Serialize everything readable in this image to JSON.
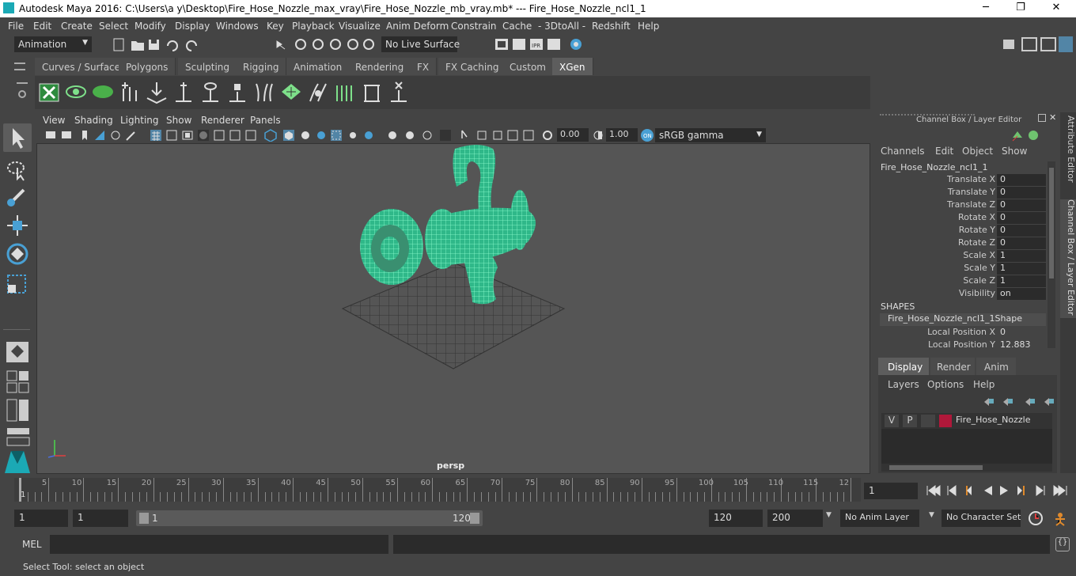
{
  "window": {
    "title": "Autodesk Maya 2016: C:\\Users\\a y\\Desktop\\Fire_Hose_Nozzle_max_vray\\Fire_Hose_Nozzle_mb_vray.mb*   ---   Fire_Hose_Nozzle_ncl1_1",
    "minimize": "─",
    "maximize": "❐",
    "close": "✕"
  },
  "menubar": [
    "File",
    "Edit",
    "Create",
    "Select",
    "Modify",
    "Display",
    "Windows",
    "Key",
    "Playback",
    "Visualize",
    "Anim Deform",
    "Constrain",
    "Cache",
    "- 3DtoAll -",
    "Redshift",
    "Help"
  ],
  "toolbar": {
    "menuset": "Animation",
    "live_surface": "No Live Surface"
  },
  "shelf_tabs": [
    "Curves / Surfaces",
    "Polygons",
    "Sculpting",
    "Rigging",
    "Animation",
    "Rendering",
    "FX",
    "FX Caching",
    "Custom",
    "XGen"
  ],
  "shelf_active": "XGen",
  "viewport": {
    "menu": [
      "View",
      "Shading",
      "Lighting",
      "Show",
      "Renderer",
      "Panels"
    ],
    "exposure": "0.00",
    "gamma": "1.00",
    "color_space": "sRGB gamma",
    "camera": "persp"
  },
  "channel_box": {
    "title": "Channel Box / Layer Editor",
    "menu": [
      "Channels",
      "Edit",
      "Object",
      "Show"
    ],
    "object": "Fire_Hose_Nozzle_ncl1_1",
    "channels": [
      {
        "label": "Translate X",
        "value": "0"
      },
      {
        "label": "Translate Y",
        "value": "0"
      },
      {
        "label": "Translate Z",
        "value": "0"
      },
      {
        "label": "Rotate X",
        "value": "0"
      },
      {
        "label": "Rotate Y",
        "value": "0"
      },
      {
        "label": "Rotate Z",
        "value": "0"
      },
      {
        "label": "Scale X",
        "value": "1"
      },
      {
        "label": "Scale Y",
        "value": "1"
      },
      {
        "label": "Scale Z",
        "value": "1"
      },
      {
        "label": "Visibility",
        "value": "on"
      }
    ],
    "shapes_header": "SHAPES",
    "shape_name": "Fire_Hose_Nozzle_ncl1_1Shape",
    "shape_channels": [
      {
        "label": "Local Position X",
        "value": "0"
      },
      {
        "label": "Local Position Y",
        "value": "12.883"
      }
    ]
  },
  "side_tabs": [
    "Attribute Editor",
    "Channel Box / Layer Editor"
  ],
  "layer_editor": {
    "tabs": [
      "Display",
      "Render",
      "Anim"
    ],
    "active_tab": "Display",
    "menu": [
      "Layers",
      "Options",
      "Help"
    ],
    "layer": {
      "v": "V",
      "p": "P",
      "name": "Fire_Hose_Nozzle",
      "color": "#b0183a"
    }
  },
  "timeline": {
    "ticks": [
      "5",
      "10",
      "15",
      "20",
      "25",
      "30",
      "35",
      "40",
      "45",
      "50",
      "55",
      "60",
      "65",
      "70",
      "75",
      "80",
      "85",
      "90",
      "95",
      "100",
      "105",
      "110",
      "115",
      "12"
    ],
    "current_marker": "1",
    "current_frame": "1"
  },
  "range": {
    "start": "1",
    "playback_start": "1",
    "slider_start": "1",
    "slider_end": "120",
    "playback_end": "120",
    "end": "200",
    "anim_layer": "No Anim Layer",
    "character_set": "No Character Set"
  },
  "mel": {
    "label": "MEL"
  },
  "status": {
    "help": "Select Tool: select an object"
  },
  "colors": {
    "wireframe": "#3ef0b0",
    "accent": "#5285a6"
  }
}
